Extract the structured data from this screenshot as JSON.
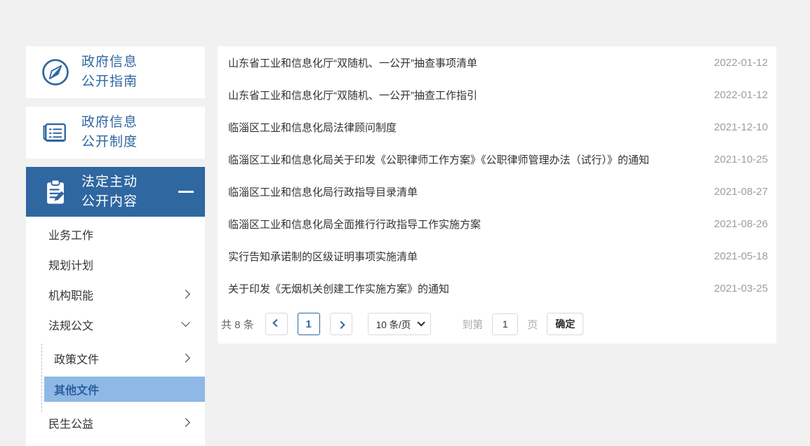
{
  "colors": {
    "accent_blue": "#2f67a1",
    "active_item_bg": "#2f67a1",
    "submenu_highlight_bg": "#90b8e6",
    "submenu_highlight_text": "#2a5f9e",
    "date_text": "#9e9e9e",
    "page_background": "#f1f1f1"
  },
  "sidebar": {
    "top_items": [
      {
        "line1": "政府信息",
        "line2": "公开指南",
        "icon": "compass-icon",
        "active": false
      },
      {
        "line1": "政府信息",
        "line2": "公开制度",
        "icon": "notebook-icon",
        "active": false
      },
      {
        "line1": "法定主动",
        "line2": "公开内容",
        "icon": "clipboard-pencil-icon",
        "active": true,
        "collapse_indicator": "minus"
      }
    ],
    "menu_items": [
      {
        "label": "业务工作",
        "chevron": "",
        "indent": false,
        "active": false
      },
      {
        "label": "规划计划",
        "chevron": "",
        "indent": false,
        "active": false
      },
      {
        "label": "机构职能",
        "chevron": "right",
        "indent": false,
        "active": false
      },
      {
        "label": "法规公文",
        "chevron": "down",
        "indent": false,
        "active": false
      },
      {
        "label": "政策文件",
        "chevron": "right",
        "indent": true,
        "active": false
      },
      {
        "label": "其他文件",
        "chevron": "",
        "indent": true,
        "active": true
      },
      {
        "label": "民生公益",
        "chevron": "right",
        "indent": false,
        "active": false
      }
    ]
  },
  "document_list": {
    "items": [
      {
        "title": "山东省工业和信息化厅“双随机、一公开”抽查事项清单",
        "date": "2022-01-12"
      },
      {
        "title": "山东省工业和信息化厅“双随机、一公开”抽查工作指引",
        "date": "2022-01-12"
      },
      {
        "title": "临淄区工业和信息化局法律顾问制度",
        "date": "2021-12-10"
      },
      {
        "title": "临淄区工业和信息化局关于印发《公职律师工作方案》《公职律师管理办法（试行）》的通知",
        "date": "2021-10-25"
      },
      {
        "title": "临淄区工业和信息化局行政指导目录清单",
        "date": "2021-08-27"
      },
      {
        "title": "临淄区工业和信息化局全面推行行政指导工作实施方案",
        "date": "2021-08-26"
      },
      {
        "title": "实行告知承诺制的区级证明事项实施清单",
        "date": "2021-05-18"
      },
      {
        "title": "关于印发《无烟机关创建工作实施方案》的通知",
        "date": "2021-03-25"
      }
    ]
  },
  "pagination": {
    "total_label": "共 8 条",
    "current_page": "1",
    "page_size_label": "10 条/页",
    "goto_prefix": "到第",
    "goto_value": "1",
    "goto_suffix": "页",
    "confirm_label": "确定"
  }
}
